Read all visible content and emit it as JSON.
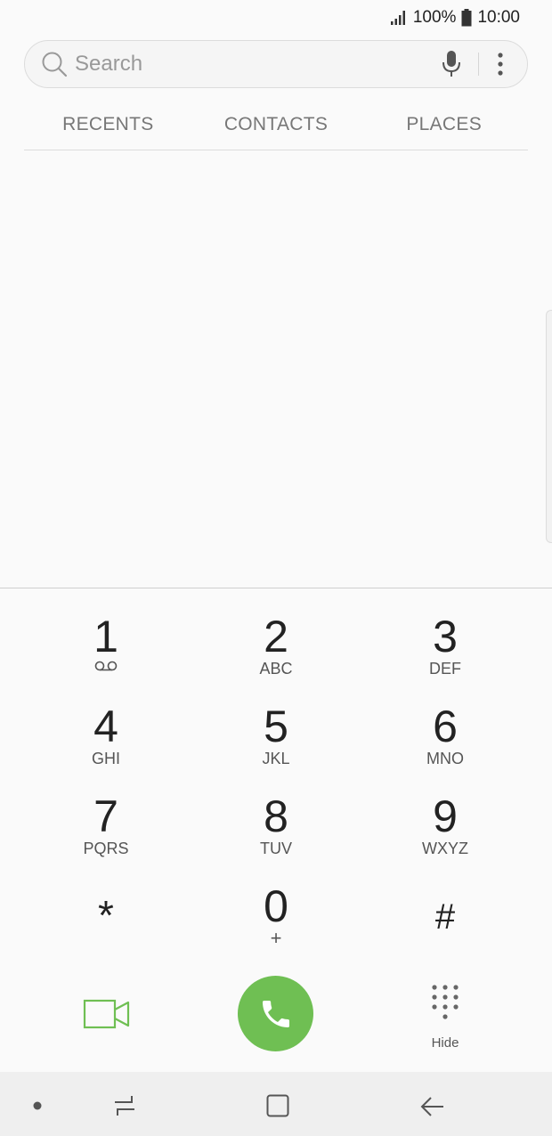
{
  "status_bar": {
    "battery": "100%",
    "time": "10:00"
  },
  "search": {
    "placeholder": "Search"
  },
  "tabs": [
    {
      "label": "RECENTS"
    },
    {
      "label": "CONTACTS"
    },
    {
      "label": "PLACES"
    }
  ],
  "keypad": {
    "keys": [
      {
        "digit": "1",
        "letters": ""
      },
      {
        "digit": "2",
        "letters": "ABC"
      },
      {
        "digit": "3",
        "letters": "DEF"
      },
      {
        "digit": "4",
        "letters": "GHI"
      },
      {
        "digit": "5",
        "letters": "JKL"
      },
      {
        "digit": "6",
        "letters": "MNO"
      },
      {
        "digit": "7",
        "letters": "PQRS"
      },
      {
        "digit": "8",
        "letters": "TUV"
      },
      {
        "digit": "9",
        "letters": "WXYZ"
      },
      {
        "digit": "*",
        "letters": ""
      },
      {
        "digit": "0",
        "letters": "+"
      },
      {
        "digit": "#",
        "letters": ""
      }
    ]
  },
  "actions": {
    "hide_label": "Hide"
  },
  "colors": {
    "accent_green": "#6fbf53"
  }
}
